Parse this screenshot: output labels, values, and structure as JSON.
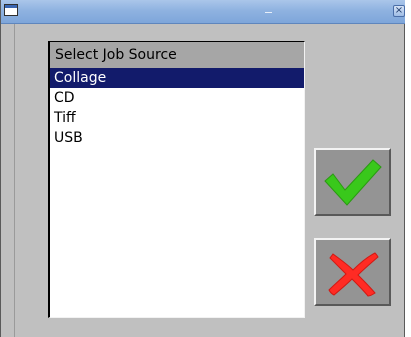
{
  "window": {
    "icons": {
      "app": "window-icon",
      "close": "close-icon"
    },
    "close_symbol": "×"
  },
  "dialog": {
    "header": "Select Job Source",
    "items": [
      {
        "label": "Collage",
        "selected": true
      },
      {
        "label": "CD",
        "selected": false
      },
      {
        "label": "Tiff",
        "selected": false
      },
      {
        "label": "USB",
        "selected": false
      }
    ],
    "confirm_icon": "checkmark-icon",
    "cancel_icon": "cross-icon"
  },
  "colors": {
    "selection_background": "#121b6b",
    "selection_text": "#ffffff",
    "header_background": "#a6a6a6",
    "button_background": "#949494",
    "check_green": "#39c81b",
    "cross_red": "#ff2b24"
  }
}
